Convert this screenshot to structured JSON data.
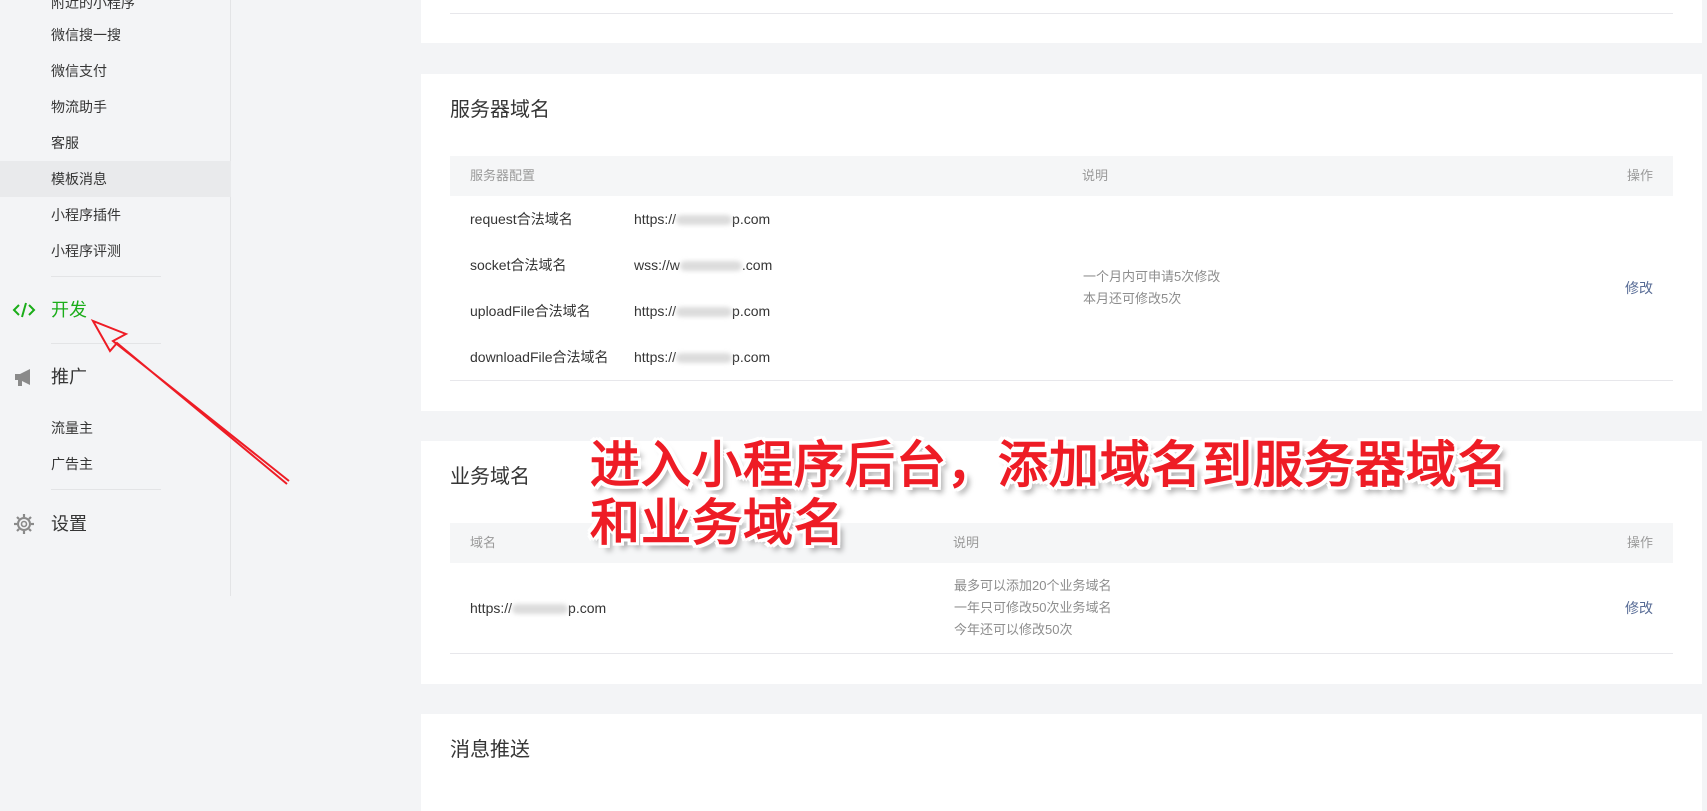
{
  "sidebar": {
    "items_top": [
      {
        "label": "附近的小程序"
      },
      {
        "label": "微信搜一搜"
      },
      {
        "label": "微信支付"
      },
      {
        "label": "物流助手"
      },
      {
        "label": "客服"
      },
      {
        "label": "模板消息"
      },
      {
        "label": "小程序插件"
      },
      {
        "label": "小程序评测"
      }
    ],
    "group_dev": {
      "label": "开发",
      "icon": "code-icon"
    },
    "group_promo": {
      "label": "推广",
      "icon": "megaphone-icon"
    },
    "items_promo": [
      {
        "label": "流量主"
      },
      {
        "label": "广告主"
      }
    ],
    "group_settings": {
      "label": "设置",
      "icon": "gear-icon"
    },
    "colors": {
      "active": "#1aad19",
      "text": "#353535"
    }
  },
  "server_domain": {
    "title": "服务器域名",
    "headers": {
      "config": "服务器配置",
      "desc": "说明",
      "op": "操作"
    },
    "rows": [
      {
        "name": "request合法域名",
        "prefix": "https://",
        "suffix": "p.com"
      },
      {
        "name": "socket合法域名",
        "prefix": "wss://w",
        "suffix": ".com"
      },
      {
        "name": "uploadFile合法域名",
        "prefix": "https://",
        "suffix": "p.com"
      },
      {
        "name": "downloadFile合法域名",
        "prefix": "https://",
        "suffix": "p.com"
      }
    ],
    "desc_lines": [
      "一个月内可申请5次修改",
      "本月还可修改5次"
    ],
    "action": "修改"
  },
  "business_domain": {
    "title": "业务域名",
    "headers": {
      "domain": "域名",
      "desc": "说明",
      "op": "操作"
    },
    "row": {
      "prefix": "https://",
      "suffix": "p.com"
    },
    "desc_lines": [
      "最多可以添加20个业务域名",
      "一年只可修改50次业务域名",
      "今年还可以修改50次"
    ],
    "action": "修改"
  },
  "message_push": {
    "title": "消息推送"
  },
  "annotation": {
    "line1": "进入小程序后台，添加域名到服务器域名",
    "line2": "和业务域名",
    "color": "#ee1c25"
  }
}
